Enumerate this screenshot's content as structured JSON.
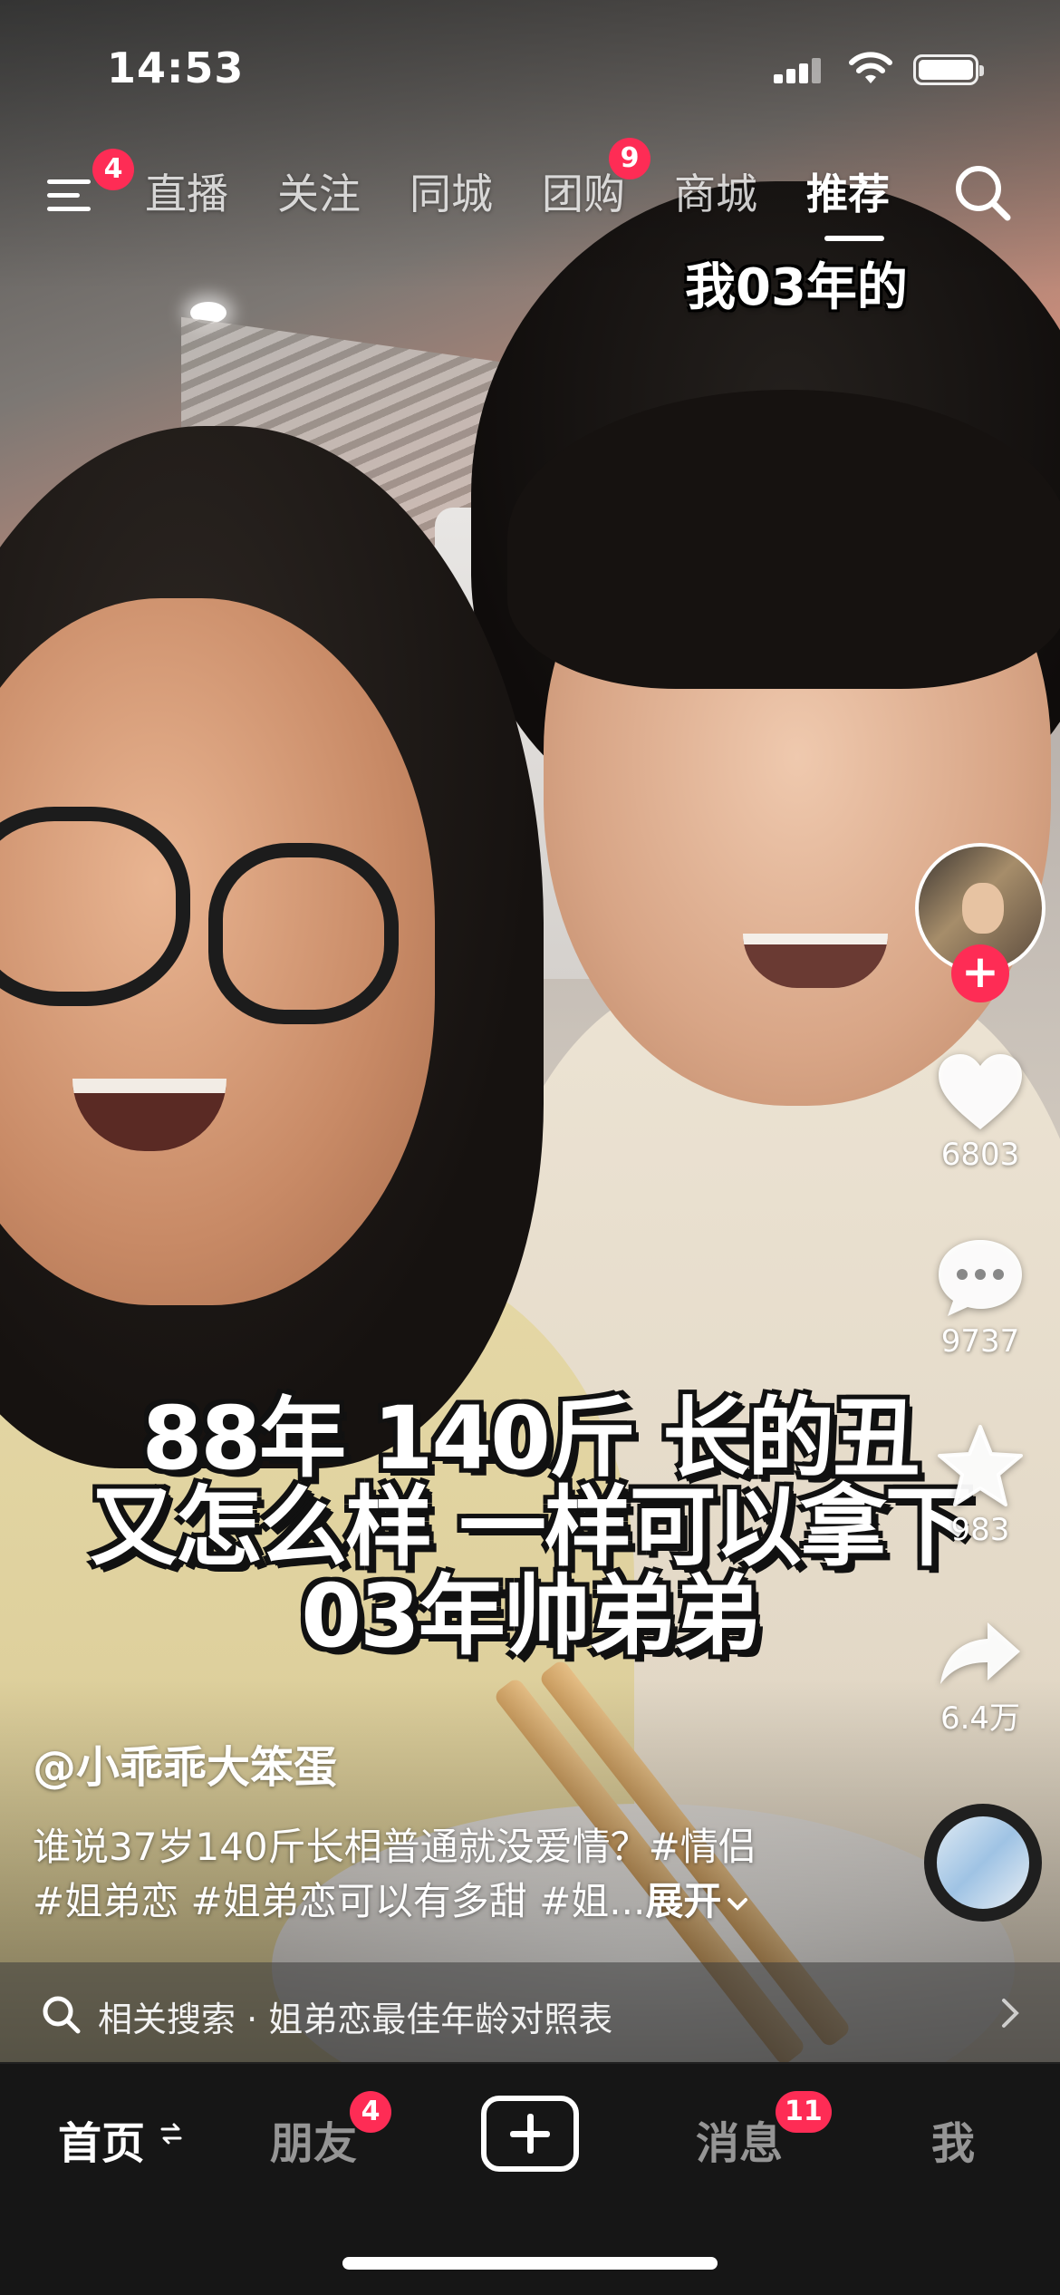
{
  "status_bar": {
    "time": "14:53"
  },
  "top_nav": {
    "menu_badge": "4",
    "tabs": [
      {
        "label": "直播"
      },
      {
        "label": "关注"
      },
      {
        "label": "同城"
      },
      {
        "label": "团购",
        "badge": "9"
      },
      {
        "label": "商城"
      },
      {
        "label": "推荐",
        "active": true
      }
    ]
  },
  "video": {
    "caption_top": "我03年的",
    "caption_lines": [
      "88年 140斤 长的丑",
      "又怎么样 一样可以拿下",
      "03年帅弟弟"
    ]
  },
  "actions": {
    "likes": "6803",
    "comments": "9737",
    "favorites": "983",
    "shares": "6.4万"
  },
  "post": {
    "author": "@小乖乖大笨蛋",
    "description_line1": "谁说37岁140斤长相普通就没爱情？#情侣",
    "description_line2": "#姐弟恋 #姐弟恋可以有多甜 #姐...",
    "expand_label": "展开"
  },
  "related_search": {
    "text": "相关搜索 · 姐弟恋最佳年龄对照表"
  },
  "bottom_nav": {
    "home": "首页",
    "friends": "朋友",
    "friends_badge": "4",
    "messages": "消息",
    "messages_badge": "11",
    "me": "我"
  },
  "colors": {
    "accent": "#fe2c55",
    "bottom_bar": "#161616"
  },
  "icons": [
    "menu-icon",
    "search-icon",
    "heart-icon",
    "comment-icon",
    "star-icon",
    "share-icon",
    "plus-icon",
    "swap-icon",
    "chevron-right-icon",
    "chevron-down-icon"
  ]
}
